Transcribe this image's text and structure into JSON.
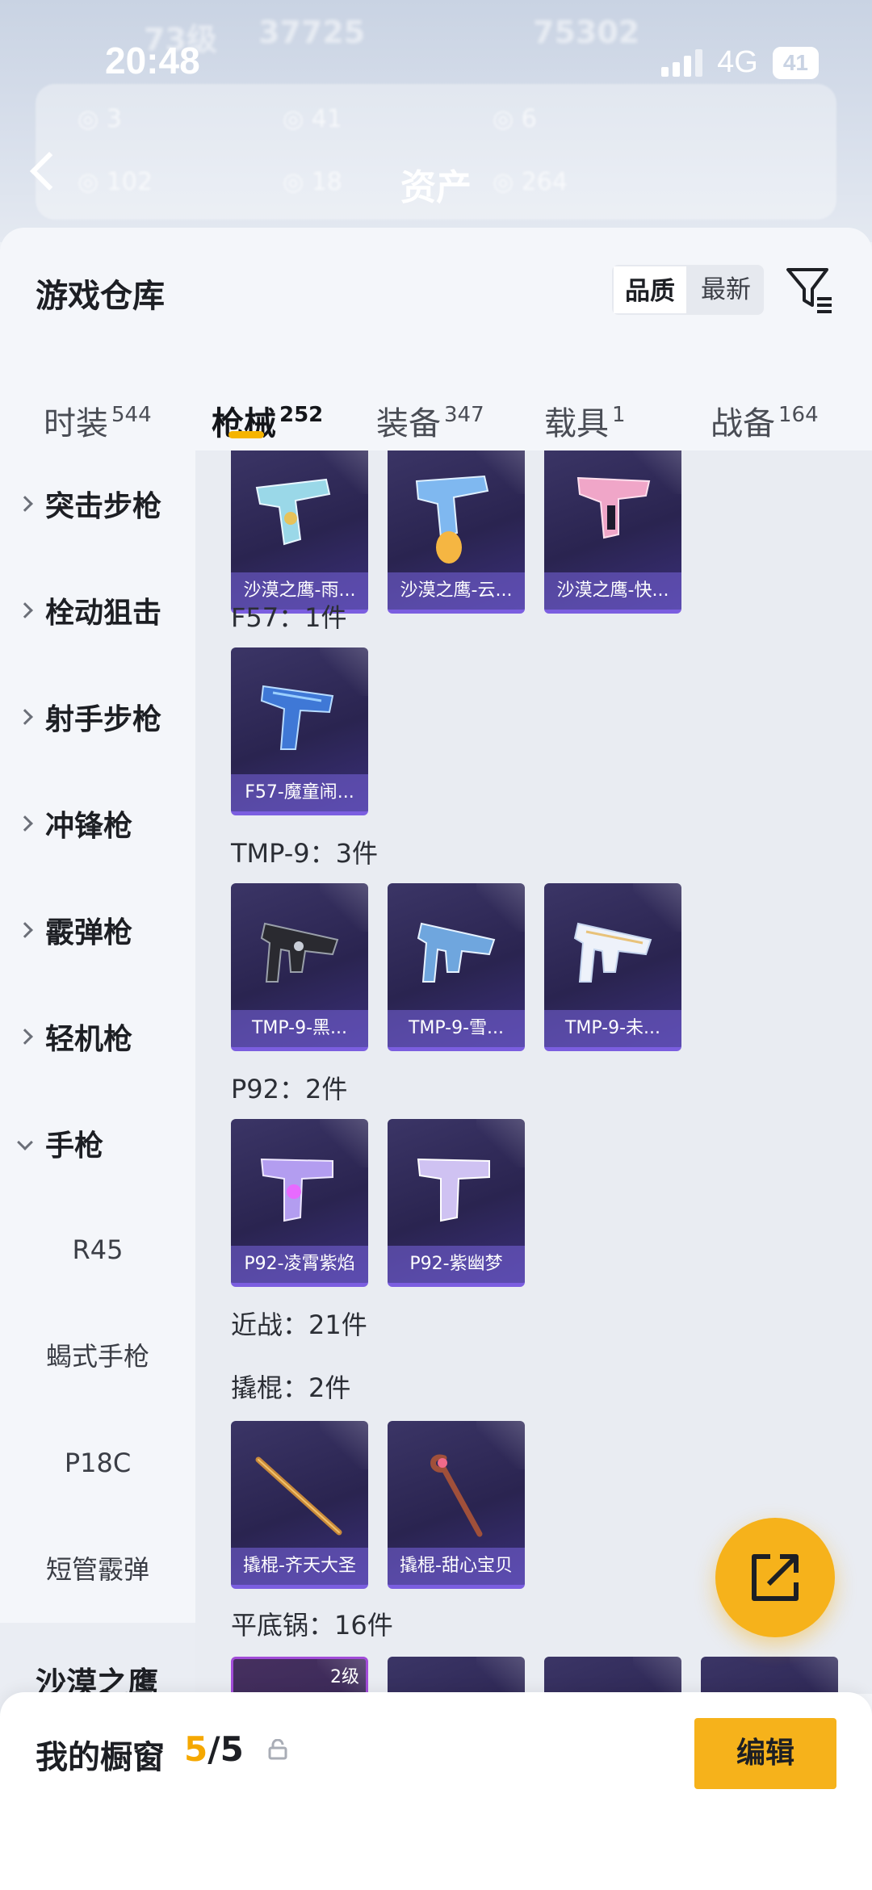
{
  "status_bar": {
    "time": "20:48",
    "network": "4G",
    "battery": "41"
  },
  "header": {
    "title": "资产",
    "blurred_level": "73级",
    "blurred_coins": "37725",
    "blurred_coins2": "75302"
  },
  "panel": {
    "title": "游戏仓库",
    "sort_options": [
      "品质",
      "最新"
    ],
    "sort_selected": "品质"
  },
  "tabs": [
    {
      "label": "时装",
      "count": "544"
    },
    {
      "label": "枪械",
      "count": "252"
    },
    {
      "label": "装备",
      "count": "347"
    },
    {
      "label": "载具",
      "count": "1"
    },
    {
      "label": "战备",
      "count": "164"
    }
  ],
  "active_tab": "枪械",
  "sidebar": {
    "categories": [
      "突击步枪",
      "栓动狙击",
      "射手步枪",
      "冲锋枪",
      "霰弹枪",
      "轻机枪",
      "手枪"
    ],
    "pistol_subitems": [
      "R45",
      "蝎式手枪",
      "P18C",
      "短管霰弹",
      "沙漠之鹰"
    ],
    "active_subitem": "沙漠之鹰"
  },
  "content": {
    "groups": [
      {
        "label": "",
        "items": [
          "沙漠之鹰-雨...",
          "沙漠之鹰-云...",
          "沙漠之鹰-快..."
        ]
      },
      {
        "label": "F57：1件",
        "items": [
          "F57-魔童闹..."
        ]
      },
      {
        "label": "TMP-9：3件",
        "items": [
          "TMP-9-黑...",
          "TMP-9-雪...",
          "TMP-9-未..."
        ]
      },
      {
        "label": "P92：2件",
        "items": [
          "P92-凌霄紫焰",
          "P92-紫幽梦"
        ]
      },
      {
        "label": "近战：21件",
        "items": []
      },
      {
        "label": "撬棍：2件",
        "items": [
          "撬棍-齐天大圣",
          "撬棍-甜心宝贝"
        ]
      },
      {
        "label": "平底锅：16件",
        "items": []
      }
    ],
    "pan_badge": "2级"
  },
  "bottom_bar": {
    "label": "我的橱窗",
    "current": "5",
    "total": "/5",
    "edit_label": "编辑"
  },
  "colors": {
    "accent": "#f6b21b",
    "card_bg": "#2a2450",
    "card_footer": "#7b5ee0"
  }
}
